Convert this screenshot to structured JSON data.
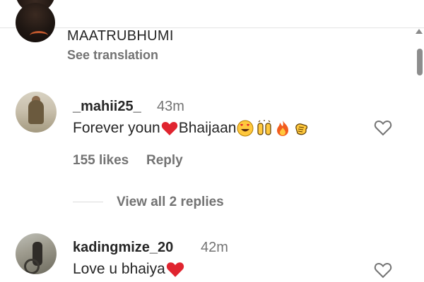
{
  "post": {
    "caption": "MAATRUBHUMI",
    "see_translation": "See translation"
  },
  "comments": [
    {
      "username": "_mahii25_",
      "time": "43m",
      "text": "Forever youn",
      "text_after_heart": "Bhaijaan",
      "emojis": [
        "red-heart",
        "heart-eyes-face",
        "raised-hands",
        "fire",
        "clapping-hands"
      ],
      "likes": "155 likes",
      "reply": "Reply",
      "view_replies": "View all 2 replies"
    },
    {
      "username": "kadingmize_20",
      "time": "42m",
      "text": "Love u bhaiya",
      "emojis": [
        "red-heart"
      ]
    }
  ],
  "colors": {
    "text": "#262626",
    "secondary": "#737373",
    "heart": "#e0242f",
    "divider": "#e3e3e3"
  }
}
